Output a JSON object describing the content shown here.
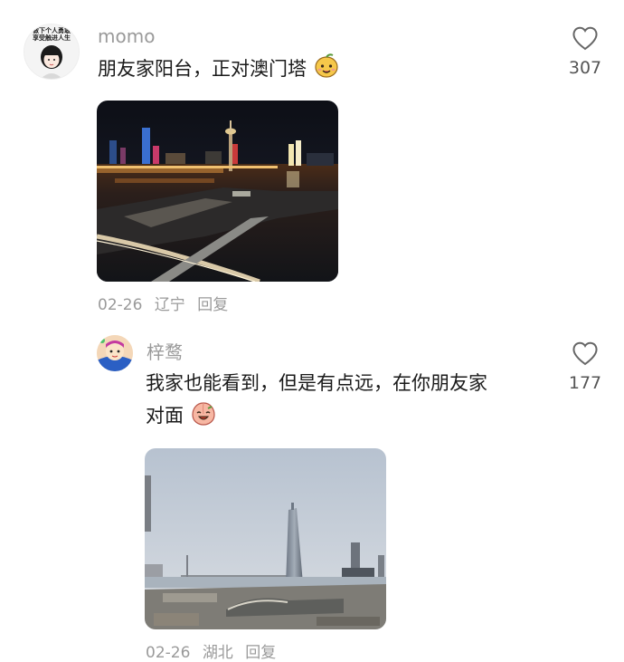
{
  "comments": [
    {
      "username": "momo",
      "avatar_text_1": "做下个人勇敢",
      "avatar_text_2": "享受触进人生",
      "text": "朋友家阳台，正对澳门塔",
      "emoji": "smiling-mango-emoji",
      "likes": "307",
      "date": "02-26",
      "location": "辽宁",
      "reply_label": "回复",
      "image": "night-view-of-macau-tower"
    },
    {
      "username": "梓鹜",
      "text_line_1": "我家也能看到，但是有点远，在你朋友家",
      "text_line_2": "对面",
      "emoji": "laughing-peach-emoji",
      "likes": "177",
      "date": "02-26",
      "location": "湖北",
      "reply_label": "回复",
      "image": "daytime-view-of-skyscraper-and-bridge"
    }
  ],
  "icons": {
    "like": "heart-outline-icon"
  },
  "colors": {
    "meta_text": "#9a9a9a",
    "body_text": "#1a1a1a"
  }
}
